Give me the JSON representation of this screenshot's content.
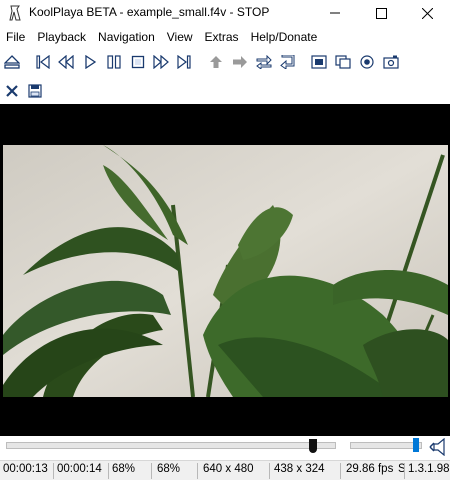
{
  "window": {
    "title": "KoolPlaya BETA - example_small.f4v - STOP",
    "controls": [
      "minimize",
      "maximize",
      "close"
    ]
  },
  "menu": [
    "File",
    "Playback",
    "Navigation",
    "View",
    "Extras",
    "Help/Donate"
  ],
  "toolbar_main": {
    "groups": [
      [
        "eject-icon"
      ],
      [
        "skip-start-icon",
        "rewind-icon",
        "play-icon",
        "pause-icon",
        "stop-icon",
        "fast-forward-icon",
        "skip-end-icon"
      ],
      [
        "arrow-up-icon",
        "arrow-right-icon",
        "swap-icon",
        "return-icon"
      ],
      [
        "fit-screen-icon",
        "copy-frame-icon",
        "record-icon",
        "screenshot-icon"
      ]
    ]
  },
  "toolbar_secondary": [
    "close-x-icon",
    "save-disk-icon"
  ],
  "video": {
    "description_hidden": true,
    "colors": {
      "wall": "#d8d4cc",
      "leaf": "#3a5f24",
      "leaf_dark": "#1f3a12",
      "bar": "#000000"
    }
  },
  "seek": {
    "position_fraction": 0.93,
    "volume_fraction": 0.92
  },
  "status": {
    "current_time": "00:00:13",
    "total_time": "00:00:14",
    "zoom1": "68%",
    "zoom2": "68%",
    "source_res": "640 x 480",
    "display_res": "438 x 324",
    "fps": "29.86 fps",
    "fps_extra": "S",
    "version": "1.3.1.98"
  }
}
